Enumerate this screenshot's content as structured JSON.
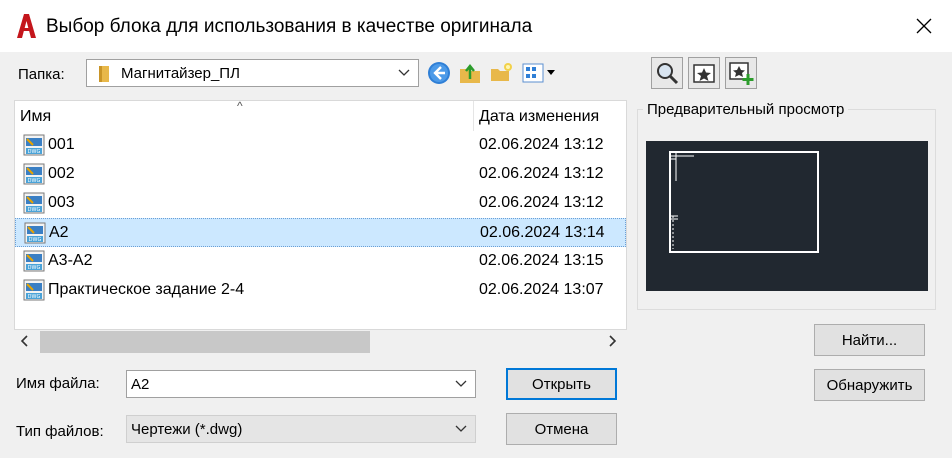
{
  "window": {
    "title": "Выбор блока для использования в качестве оригинала",
    "icon": "autocad-a-icon",
    "accent_color": "#c4161c"
  },
  "toolbar": {
    "folder_label": "Папка:",
    "folder_value": "Магнитайзер_ПЛ",
    "icons": [
      "back-icon",
      "up-folder-icon",
      "new-folder-icon",
      "views-menu-icon"
    ]
  },
  "right_toolbar": {
    "icons": [
      "search-web-icon",
      "favorites-icon",
      "add-to-favorites-icon"
    ]
  },
  "file_list": {
    "columns": [
      "Имя",
      "Дата изменения"
    ],
    "rows": [
      {
        "name": "001",
        "date": "02.06.2024 13:12",
        "selected": false
      },
      {
        "name": "002",
        "date": "02.06.2024 13:12",
        "selected": false
      },
      {
        "name": "003",
        "date": "02.06.2024 13:12",
        "selected": false
      },
      {
        "name": "A2",
        "date": "02.06.2024 13:14",
        "selected": true
      },
      {
        "name": "A3-A2",
        "date": "02.06.2024 13:15",
        "selected": false
      },
      {
        "name": "Практическое задание 2-4",
        "date": "02.06.2024 13:07",
        "selected": false
      }
    ]
  },
  "preview": {
    "label": "Предварительный просмотр",
    "background": "#212830"
  },
  "filename": {
    "label": "Имя файла:",
    "value": "A2"
  },
  "filetype": {
    "label": "Тип файлов:",
    "value": "Чертежи (*.dwg)"
  },
  "buttons": {
    "open": "Открыть",
    "cancel": "Отмена",
    "find": "Найти...",
    "locate": "Обнаружить"
  }
}
